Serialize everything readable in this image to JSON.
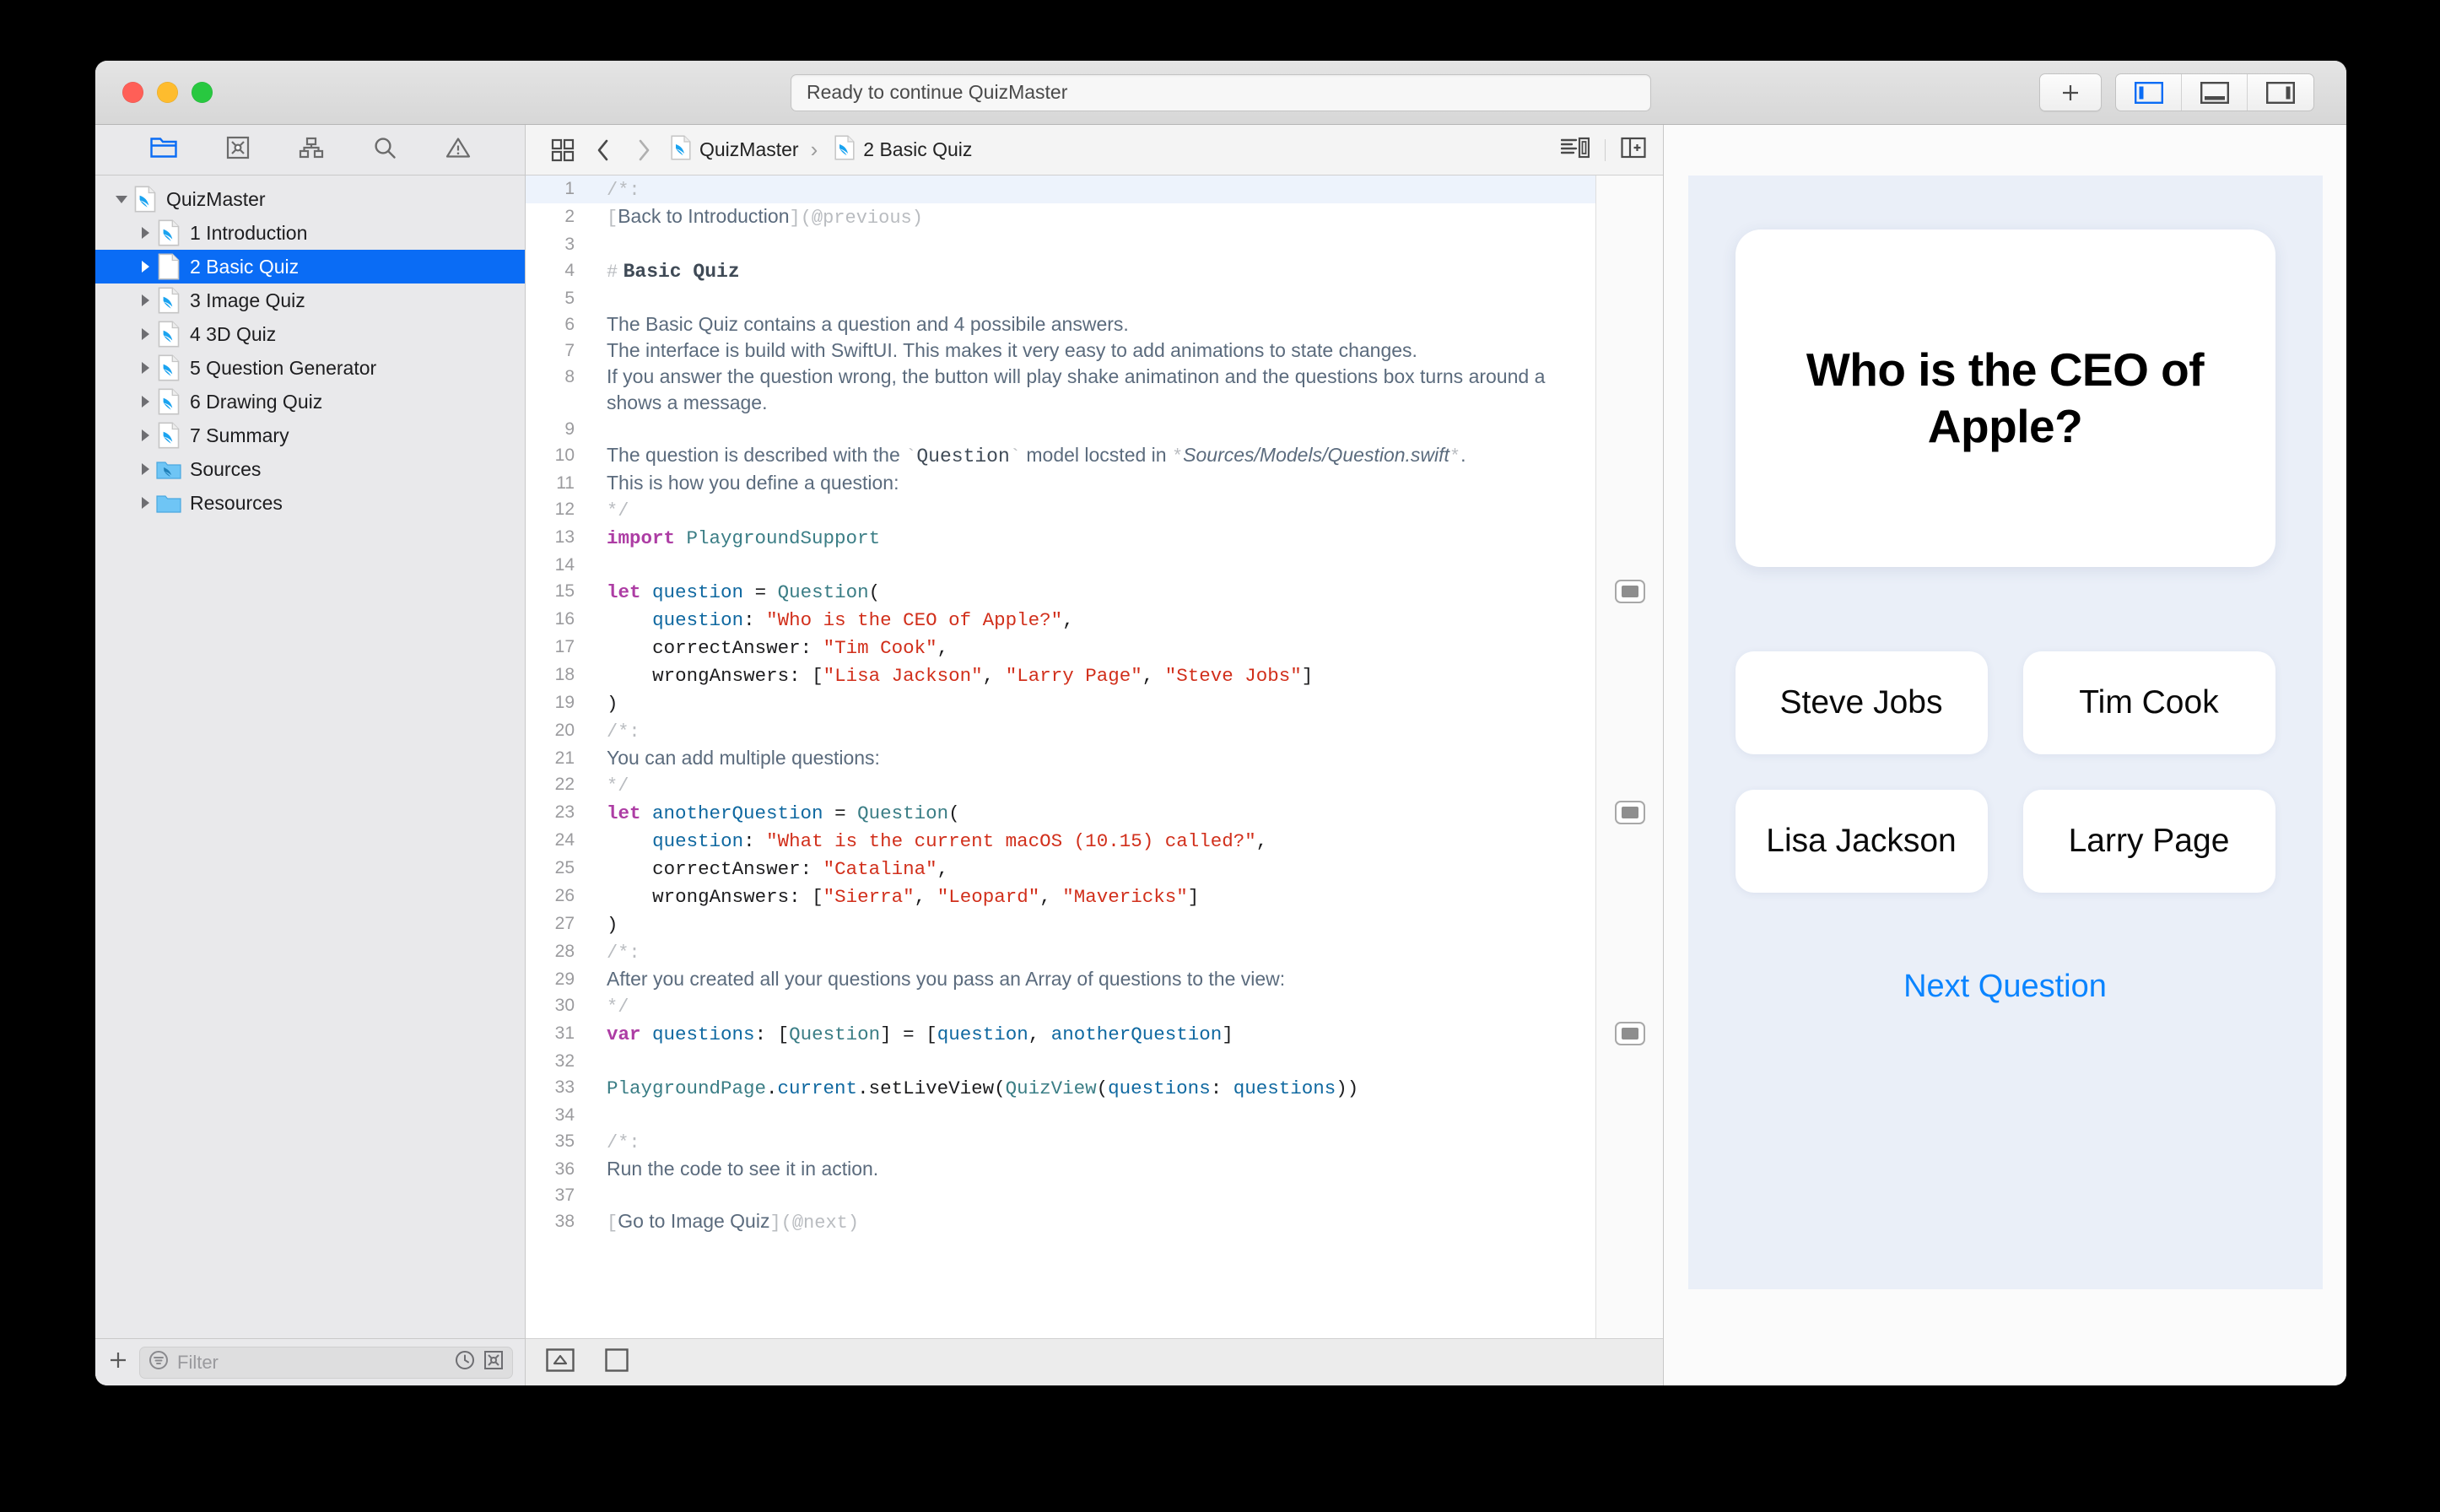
{
  "window": {
    "status_text": "Ready to continue QuizMaster",
    "traffic_lights": [
      "close-button",
      "minimize-button",
      "zoom-button"
    ],
    "toolbar_right": {
      "add_label": "+",
      "segments": [
        "left-pane-toggle",
        "bottom-pane-toggle",
        "right-pane-toggle"
      ],
      "active_segment": 0
    },
    "accent_color": "#0a6cf5"
  },
  "navigator": {
    "toolbar_icons": [
      "project-navigator-icon",
      "issue-navigator-icon",
      "hierarchy-navigator-icon",
      "search-navigator-icon",
      "warning-navigator-icon"
    ],
    "active_toolbar_icon": 0,
    "tree": [
      {
        "label": "QuizMaster",
        "depth": 0,
        "icon": "swift-playground-icon",
        "twisty": "down",
        "selected": false
      },
      {
        "label": "1 Introduction",
        "depth": 1,
        "icon": "swift-page-icon",
        "twisty": "right",
        "selected": false
      },
      {
        "label": "2 Basic Quiz",
        "depth": 1,
        "icon": "swift-page-icon",
        "twisty": "right",
        "selected": true
      },
      {
        "label": "3 Image Quiz",
        "depth": 1,
        "icon": "swift-page-icon",
        "twisty": "right",
        "selected": false
      },
      {
        "label": "4 3D Quiz",
        "depth": 1,
        "icon": "swift-page-icon",
        "twisty": "right",
        "selected": false
      },
      {
        "label": "5 Question Generator",
        "depth": 1,
        "icon": "swift-page-icon",
        "twisty": "right",
        "selected": false
      },
      {
        "label": "6 Drawing Quiz",
        "depth": 1,
        "icon": "swift-page-icon",
        "twisty": "right",
        "selected": false
      },
      {
        "label": "7 Summary",
        "depth": 1,
        "icon": "swift-page-icon",
        "twisty": "right",
        "selected": false
      },
      {
        "label": "Sources",
        "depth": 1,
        "icon": "swift-folder-icon",
        "twisty": "right",
        "selected": false
      },
      {
        "label": "Resources",
        "depth": 1,
        "icon": "folder-icon",
        "twisty": "right",
        "selected": false
      }
    ],
    "filter": {
      "add_label": "+",
      "placeholder": "Filter",
      "value": "",
      "trailing_icons": [
        "recent-icon",
        "issues-filter-icon"
      ]
    }
  },
  "editor": {
    "jumpbar": {
      "related_items_icon": "related-items-icon",
      "back_label": "‹",
      "forward_label": "›",
      "breadcrumbs": [
        {
          "label": "QuizMaster",
          "icon": "swift-playground-icon"
        },
        {
          "label": "2 Basic Quiz",
          "icon": "swift-page-icon"
        }
      ],
      "right_icons": [
        "minimap-icon",
        "add-editor-icon"
      ]
    },
    "bottom_bar_icons": [
      "run-stop-icon",
      "execute-icon"
    ],
    "result_marker_lines": [
      15,
      23,
      31
    ],
    "lines": [
      {
        "n": 1,
        "kind": "comment-open",
        "text": "/*:",
        "highlight": true
      },
      {
        "n": 2,
        "kind": "markdown-link",
        "text": "[Back to Introduction](@previous)"
      },
      {
        "n": 3,
        "kind": "blank",
        "text": ""
      },
      {
        "n": 4,
        "kind": "markdown-heading",
        "text": "# Basic Quiz"
      },
      {
        "n": 5,
        "kind": "blank",
        "text": ""
      },
      {
        "n": 6,
        "kind": "markdown",
        "text": "The Basic Quiz contains a question and 4 possibile answers."
      },
      {
        "n": 7,
        "kind": "markdown",
        "text": "The interface is build with SwiftUI. This makes it very easy to add animations to state changes."
      },
      {
        "n": 8,
        "kind": "markdown",
        "text": "If you answer the question wrong, the button will play shake animatinon and the questions box turns around a shows a message."
      },
      {
        "n": 9,
        "kind": "blank",
        "text": ""
      },
      {
        "n": 10,
        "kind": "markdown-mixed",
        "text": "The question is described with the `Question` model locsted in *Sources/Models/Question.swift*."
      },
      {
        "n": 11,
        "kind": "markdown",
        "text": "This is how you define a question:"
      },
      {
        "n": 12,
        "kind": "comment-close",
        "text": "*/"
      },
      {
        "n": 13,
        "kind": "code",
        "text": "import PlaygroundSupport"
      },
      {
        "n": 14,
        "kind": "blank",
        "text": ""
      },
      {
        "n": 15,
        "kind": "code",
        "text": "let question = Question("
      },
      {
        "n": 16,
        "kind": "code",
        "text": "    question: \"Who is the CEO of Apple?\","
      },
      {
        "n": 17,
        "kind": "code",
        "text": "    correctAnswer: \"Tim Cook\","
      },
      {
        "n": 18,
        "kind": "code",
        "text": "    wrongAnswers: [\"Lisa Jackson\", \"Larry Page\", \"Steve Jobs\"]"
      },
      {
        "n": 19,
        "kind": "code",
        "text": ")"
      },
      {
        "n": 20,
        "kind": "comment-open",
        "text": "/*:"
      },
      {
        "n": 21,
        "kind": "markdown",
        "text": "You can add multiple questions:"
      },
      {
        "n": 22,
        "kind": "comment-close",
        "text": "*/"
      },
      {
        "n": 23,
        "kind": "code",
        "text": "let anotherQuestion = Question("
      },
      {
        "n": 24,
        "kind": "code",
        "text": "    question: \"What is the current macOS (10.15) called?\","
      },
      {
        "n": 25,
        "kind": "code",
        "text": "    correctAnswer: \"Catalina\","
      },
      {
        "n": 26,
        "kind": "code",
        "text": "    wrongAnswers: [\"Sierra\", \"Leopard\", \"Mavericks\"]"
      },
      {
        "n": 27,
        "kind": "code",
        "text": ")"
      },
      {
        "n": 28,
        "kind": "comment-open",
        "text": "/*:"
      },
      {
        "n": 29,
        "kind": "markdown",
        "text": "After you created all your questions you pass an Array of questions to the view:"
      },
      {
        "n": 30,
        "kind": "comment-close",
        "text": "*/"
      },
      {
        "n": 31,
        "kind": "code",
        "text": "var questions: [Question] = [question, anotherQuestion]"
      },
      {
        "n": 32,
        "kind": "blank",
        "text": ""
      },
      {
        "n": 33,
        "kind": "code",
        "text": "PlaygroundPage.current.setLiveView(QuizView(questions: questions))"
      },
      {
        "n": 34,
        "kind": "blank",
        "text": ""
      },
      {
        "n": 35,
        "kind": "comment-open",
        "text": "/*:"
      },
      {
        "n": 36,
        "kind": "markdown",
        "text": "Run the code to see it in action."
      },
      {
        "n": 37,
        "kind": "blank",
        "text": ""
      },
      {
        "n": 38,
        "kind": "markdown-link",
        "text": "[Go to Image Quiz](@next)"
      }
    ]
  },
  "liveview": {
    "question": "Who is the CEO of Apple?",
    "answers": [
      "Steve Jobs",
      "Tim Cook",
      "Lisa Jackson",
      "Larry Page"
    ],
    "next_label": "Next Question",
    "link_color": "#0a84ff",
    "stage_background": "#eaeff8"
  }
}
